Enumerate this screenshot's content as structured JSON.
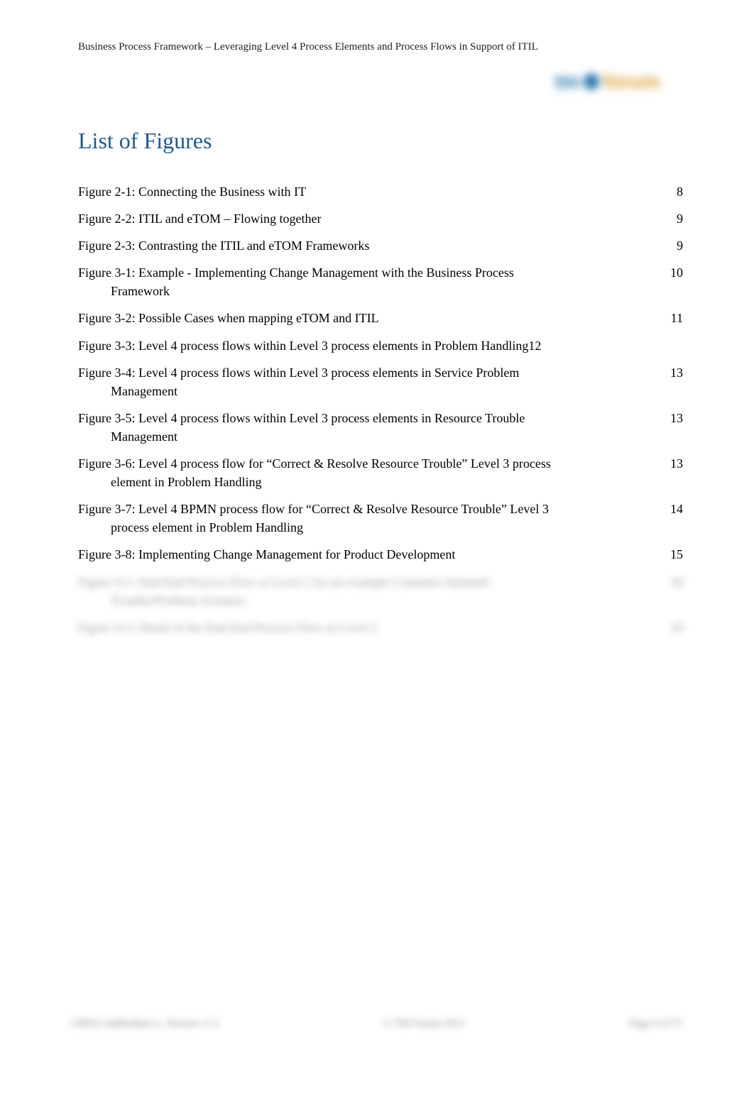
{
  "header": {
    "running_title": "Business Process Framework – Leveraging Level 4 Process Elements and Process Flows in Support of ITIL"
  },
  "logo": {
    "part1": "tm",
    "part2": "forum"
  },
  "section_title": "List of Figures",
  "figures": [
    {
      "label": "Figure 2-1: Connecting the Business with IT",
      "cont": "",
      "page": "8"
    },
    {
      "label": "Figure 2-2: ITIL and eTOM – Flowing together",
      "cont": "",
      "page": "9"
    },
    {
      "label": "Figure 2-3: Contrasting the ITIL and eTOM Frameworks",
      "cont": "",
      "page": "9"
    },
    {
      "label": "Figure 3-1: Example - Implementing Change Management with the Business Process",
      "cont": "Framework",
      "page": "10"
    },
    {
      "label": "Figure 3-2: Possible Cases when mapping eTOM and ITIL",
      "cont": "",
      "page": "11"
    },
    {
      "label": "Figure 3-3: Level 4 process flows within Level 3 process elements in Problem Handling12",
      "cont": "",
      "page": ""
    },
    {
      "label": "Figure 3-4: Level 4 process flows within Level 3 process elements in Service Problem",
      "cont": "Management",
      "page": "13"
    },
    {
      "label": "Figure 3-5: Level 4 process flows within Level 3 process elements in Resource Trouble",
      "cont": "Management",
      "page": "13"
    },
    {
      "label": "Figure 3-6: Level 4 process flow for “Correct & Resolve Resource Trouble” Level 3 process",
      "cont": "element in Problem Handling",
      "page": "13"
    },
    {
      "label": "Figure 3-7: Level 4 BPMN process flow for “Correct & Resolve Resource Trouble” Level 3",
      "cont": "process element in Problem Handling",
      "page": "14"
    },
    {
      "label": "Figure 3-8: Implementing Change Management for Product Development",
      "cont": "",
      "page": "15"
    }
  ],
  "blurred_figures": [
    {
      "label": "Figure 4-1: End-End Process Flow at Level 2 for an example Customer Initiated",
      "cont": "Trouble/Problem Scenario",
      "page": "18"
    },
    {
      "label": "Figure 4-2: Detail of the End-End Process Flow at Level 2",
      "cont": "",
      "page": "18"
    }
  ],
  "footer": {
    "left": "GB921 Addendum L, Version 11.3",
    "center": "© TM Forum 2011",
    "right": "Page 4 of 37"
  }
}
